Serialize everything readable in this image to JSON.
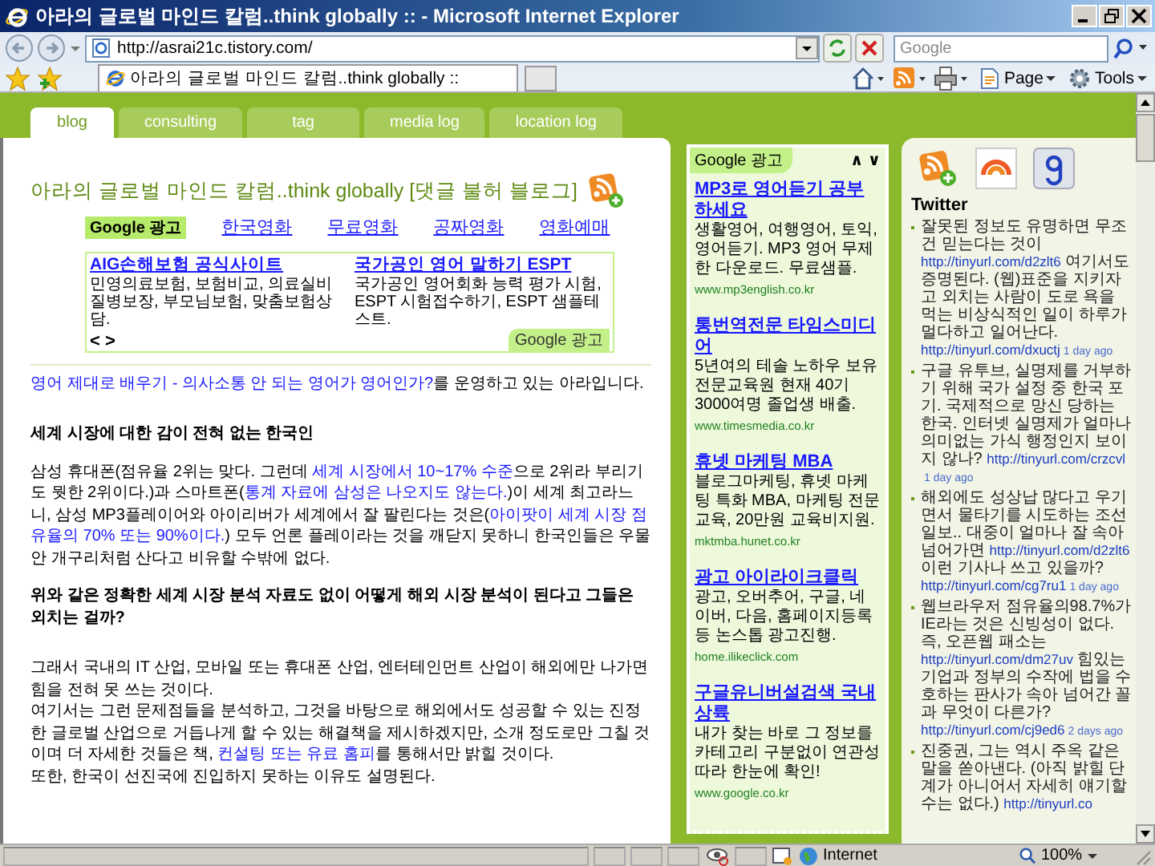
{
  "window": {
    "title": "아라의 글로벌 마인드 칼럼..think globally :: - Microsoft Internet Explorer",
    "address": "http://asrai21c.tistory.com/",
    "search": {
      "placeholder": "Google"
    }
  },
  "browser_tabs": [
    {
      "label": "아라의 글로벌 마인드 칼럼..think globally ::",
      "selected": true
    }
  ],
  "command_bar": [
    "Page",
    "Tools"
  ],
  "blog_tabs": [
    {
      "label": "blog",
      "selected": true
    },
    {
      "label": "consulting",
      "selected": false
    },
    {
      "label": "tag",
      "selected": false
    },
    {
      "label": "media log",
      "selected": false
    },
    {
      "label": "location log",
      "selected": false
    }
  ],
  "blog": {
    "title": "아라의 글로벌 마인드 칼럼..think globally [댓글 불허 블로그]",
    "ad_links": {
      "badge": "Google 광고",
      "links": [
        "한국영화",
        "무료영화",
        "공짜영화",
        "영화예매"
      ]
    },
    "ad_box": {
      "ads": [
        {
          "title": "AIG손해보험 공식사이트",
          "text": "민영의료보험, 보험비교, 의료실비 질병보장, 부모님보험, 맞춤보험상담."
        },
        {
          "title": "국가공인 영어 말하기 ESPT",
          "text": "국가공인 영어회화 능력 평가 시험, ESPT 시험접수하기, ESPT 샘플테스트."
        }
      ],
      "nav": "< >",
      "badge": "Google 광고"
    },
    "intro": {
      "link": "영어 제대로 배우기 - 의사소통 안 되는 영어가 영어인가?",
      "text": "를 운영하고 있는 아라입니다."
    },
    "article": [
      {
        "kind": "heading",
        "segments": [
          {
            "text": "세계 시장에 대한 감이 전혀 없는 한국인",
            "kind": "plain"
          }
        ]
      },
      {
        "kind": "paragraph",
        "segments": [
          {
            "text": "삼성 휴대폰(점유율 2위는 맞다. 그런데 ",
            "kind": "plain"
          },
          {
            "text": "세계 시장에서 10~17% 수준",
            "kind": "blue"
          },
          {
            "text": "으로 2위라 부리기도 뭣한 2위이다.)과 스마트폰(",
            "kind": "plain"
          },
          {
            "text": "통계 자료에 삼성은 나오지도 않는다.",
            "kind": "blue"
          },
          {
            "text": ")이 세계 최고라느니, 삼성 MP3플레이어와 아이리버가 세계에서 잘 팔린다는 것은(",
            "kind": "plain"
          },
          {
            "text": "아이팟이 세계 시장 점유율의 70% 또는 90%이다.",
            "kind": "blue"
          },
          {
            "text": ") 모두 언론 플레이라는 것을 깨닫지 못하니 한국인들은 우물 안 개구리처럼 산다고 비유할 수밖에 없다.",
            "kind": "plain"
          }
        ]
      },
      {
        "kind": "question",
        "segments": [
          {
            "text": "위와 같은 정확한 세계 시장 분석 자료도 없이 어떻게 해외 시장 분석이 된다고 그들은 외치는 걸까?",
            "kind": "plain"
          }
        ]
      },
      {
        "kind": "section",
        "segments": [
          {
            "text": "그래서 국내의 IT 산업, 모바일 또는 휴대폰 산업, 엔터테인먼트 산업이 해외에만 나가면 힘을 전혀 못 쓰는 것이다.",
            "kind": "plain"
          }
        ]
      },
      {
        "kind": "line",
        "segments": [
          {
            "text": "여기서는 그런 문제점들을 분석하고, 그것을 바탕으로 해외에서도 성공할 수 있는 진정한 글로벌 산업으로 거듭나게 할 수 있는 해결책을 제시하겠지만, 소개 정도로만 그칠 것이며 더 자세한 것들은 책, ",
            "kind": "plain"
          },
          {
            "text": "컨설팅 또는 유료 홈피",
            "kind": "blue"
          },
          {
            "text": "를 통해서만 밝힐 것이다.",
            "kind": "plain"
          }
        ]
      },
      {
        "kind": "line",
        "segments": [
          {
            "text": "또한, 한국이 선진국에 진입하지 못하는 이유도 설명된다.",
            "kind": "plain"
          }
        ]
      }
    ]
  },
  "side_ads": {
    "badge": "Google 광고",
    "arrows": "∧ ∨",
    "ads": [
      {
        "title": "MP3로 영어듣기 공부하세요",
        "text": "생활영어, 여행영어, 토익, 영어듣기. MP3 영어 무제한 다운로드. 무료샘플.",
        "url": "www.mp3english.co.kr"
      },
      {
        "title": "통번역전문 타임스미디어",
        "text": "5년여의 테솔 노하우 보유 전문교육원 현재 40기 3000여명 졸업생 배출.",
        "url": "www.timesmedia.co.kr"
      },
      {
        "title": "휴넷 마케팅 MBA",
        "text": "블로그마케팅, 휴넷 마케팅 특화 MBA, 마케팅 전문교육, 20만원 교육비지원.",
        "url": "mktmba.hunet.co.kr"
      },
      {
        "title": "광고 아이라이크클릭",
        "text": "광고, 오버추어, 구글, 네이버, 다음, 홈페이지등록 등 논스톱 광고진행.",
        "url": "home.ilikeclick.com"
      },
      {
        "title": "구글유니버설검색 국내상륙",
        "text": "내가 찾는 바로 그 정보를 카테고리 구분없이 연관성따라 한눈에 확인!",
        "url": "www.google.co.kr"
      }
    ]
  },
  "twitter": {
    "title": "Twitter",
    "tweets": [
      {
        "segments": [
          {
            "kind": "text",
            "text": "잘못된 정보도 유명하면 무조건 믿는다는 것이 "
          },
          {
            "kind": "link",
            "text": "http://tinyurl.com/d2zlt6"
          },
          {
            "kind": "text",
            "text": " 여기서도 증명된다. (웹)표준을 지키자고 외치는 사람이 도로 욕을 먹는 비상식적인 일이 하루가 멀다하고 일어난다. "
          },
          {
            "kind": "link",
            "text": "http://tinyurl.com/dxuctj"
          }
        ],
        "time": "1 day ago"
      },
      {
        "segments": [
          {
            "kind": "text",
            "text": "구글 유투브, 실명제를 거부하기 위해 국가 설정 중 한국 포기. 국제적으로 망신 당하는 한국. 인터넷 실명제가 얼마나 의미없는 가식 행정인지 보이지 않나? "
          },
          {
            "kind": "link",
            "text": "http://tinyurl.com/crzcvl"
          }
        ],
        "time": "1 day ago"
      },
      {
        "segments": [
          {
            "kind": "text",
            "text": "해외에도 성상납 많다고 우기면서 물타기를 시도하는 조선일보.. 대중이 얼마나 잘 속아 넘어가면 "
          },
          {
            "kind": "link",
            "text": "http://tinyurl.com/d2zlt6"
          },
          {
            "kind": "text",
            "text": " 이런 기사나 쓰고 있을까? "
          },
          {
            "kind": "link",
            "text": "http://tinyurl.com/cg7ru1"
          }
        ],
        "time": "1 day ago"
      },
      {
        "segments": [
          {
            "kind": "text",
            "text": "웹브라우저 점유율의98.7%가 IE라는 것은 신빙성이 없다. 즉, 오픈웹 패소는"
          },
          {
            "kind": "link",
            "text": "http://tinyurl.com/dm27uv"
          },
          {
            "kind": "text",
            "text": " 힘있는 기업과 정부의 수작에 법을 수호하는 판사가 속아 넘어간 꼴과 무엇이 다른가?"
          },
          {
            "kind": "link",
            "text": "http://tinyurl.com/cj9ed6"
          }
        ],
        "time": "2 days ago"
      },
      {
        "segments": [
          {
            "kind": "text",
            "text": "진중권, 그는 역시 주옥 같은 말을 쏟아낸다. (아직 밝힐 단계가 아니어서 자세히 얘기할 수는 없다.) "
          },
          {
            "kind": "link",
            "text": "http://tinyurl.co"
          }
        ]
      }
    ]
  },
  "status_bar": {
    "zone": "Internet",
    "zoom": "100%"
  }
}
